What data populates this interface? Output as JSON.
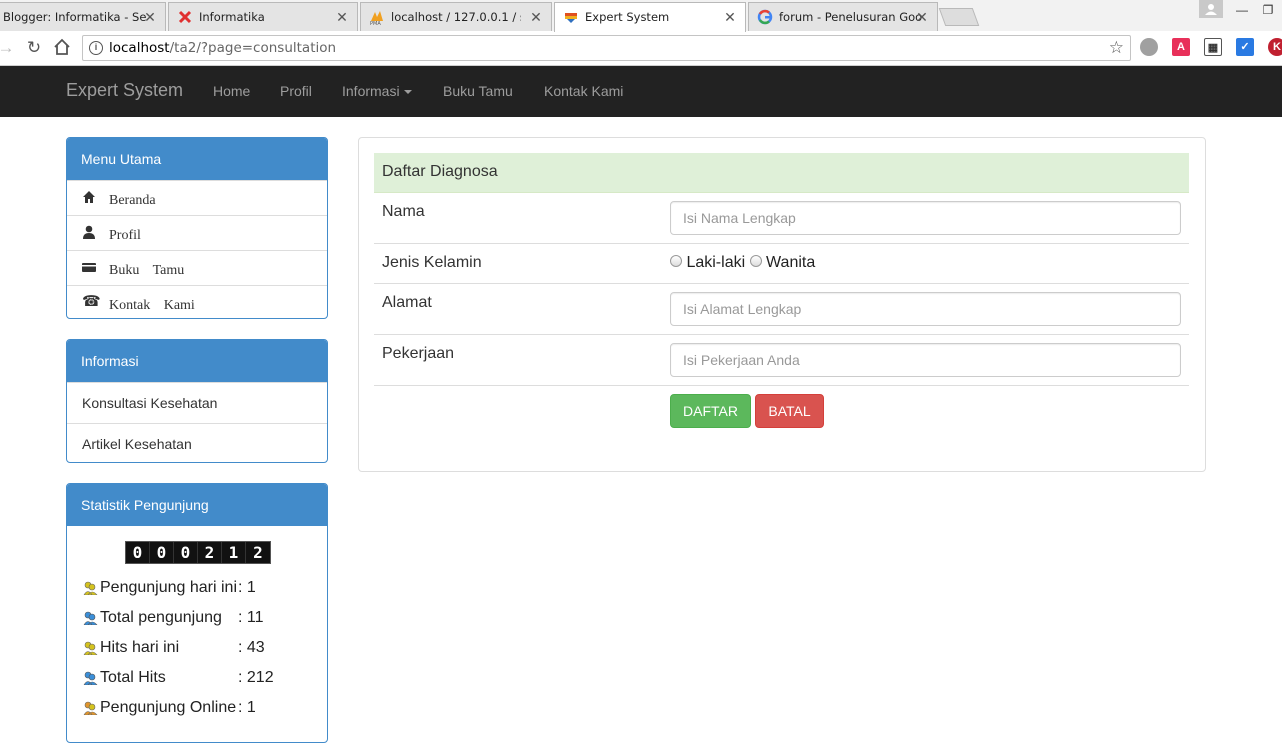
{
  "browser": {
    "tabs": [
      {
        "title": "Blogger: Informatika - Se",
        "icon": "blogger-icon"
      },
      {
        "title": "Informatika",
        "icon": "red-x-icon"
      },
      {
        "title": "localhost / 127.0.0.1 / sis",
        "icon": "phpmyadmin-icon"
      },
      {
        "title": "Expert System",
        "icon": "expert-system-icon"
      },
      {
        "title": "forum - Penelusuran Goo",
        "icon": "google-icon"
      }
    ],
    "address": {
      "host": "localhost",
      "path": "/ta2/?page=consultation"
    }
  },
  "navbar": {
    "brand": "Expert System",
    "links": [
      "Home",
      "Profil",
      "Informasi",
      "Buku Tamu",
      "Kontak Kami"
    ]
  },
  "sidebar": {
    "menu_utama": {
      "title": "Menu Utama",
      "items": [
        {
          "label": "Beranda",
          "icon": "home-icon"
        },
        {
          "label": "Profil",
          "icon": "user-icon"
        },
        {
          "label": "Buku Tamu",
          "icon": "book-icon"
        },
        {
          "label": "Kontak Kami",
          "icon": "phone-icon"
        }
      ]
    },
    "informasi": {
      "title": "Informasi",
      "items": [
        "Konsultasi Kesehatan",
        "Artikel Kesehatan"
      ]
    },
    "statistik": {
      "title": "Statistik Pengunjung",
      "counter": [
        "0",
        "0",
        "0",
        "2",
        "1",
        "2"
      ],
      "rows": [
        {
          "label": "Pengunjung hari ini",
          "value": ": 1",
          "icon_color": "#d4c21e"
        },
        {
          "label": "Total pengunjung",
          "value": ": 11",
          "icon_color": "#3a8fd9"
        },
        {
          "label": "Hits hari ini",
          "value": ": 43",
          "icon_color": "#d4c21e"
        },
        {
          "label": "Total Hits",
          "value": ": 212",
          "icon_color": "#3a8fd9"
        },
        {
          "label": "Pengunjung Online",
          "value": ": 1",
          "icon_color": "#e0952c"
        }
      ]
    }
  },
  "form": {
    "title": "Daftar Diagnosa",
    "nama": {
      "label": "Nama",
      "placeholder": "Isi Nama Lengkap"
    },
    "jenis_kelamin": {
      "label": "Jenis Kelamin",
      "option1": "Laki-laki",
      "option2": "Wanita"
    },
    "alamat": {
      "label": "Alamat",
      "placeholder": "Isi Alamat Lengkap"
    },
    "pekerjaan": {
      "label": "Pekerjaan",
      "placeholder": "Isi Pekerjaan Anda"
    },
    "submit_label": "DAFTAR",
    "cancel_label": "BATAL"
  },
  "colors": {
    "primary": "#428bca",
    "success": "#5cb85c",
    "danger": "#d9534f",
    "navbar": "#222222",
    "form_head": "#dff0d8"
  }
}
